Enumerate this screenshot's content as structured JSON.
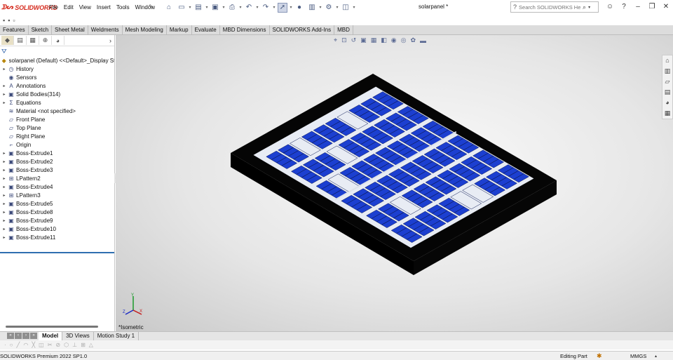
{
  "title_bar": {
    "logo_text": "SOLIDWORKS",
    "menus": [
      "File",
      "Edit",
      "View",
      "Insert",
      "Tools",
      "Window"
    ],
    "document_title": "solarpanel *",
    "search_placeholder": "Search SOLIDWORKS Help"
  },
  "command_tabs": [
    "Features",
    "Sketch",
    "Sheet Metal",
    "Weldments",
    "Mesh Modeling",
    "Markup",
    "Evaluate",
    "MBD Dimensions",
    "SOLIDWORKS Add-Ins",
    "MBD"
  ],
  "feature_tree": {
    "root": "solarpanel (Default) <<Default>_Display Stat",
    "items": [
      {
        "label": "History",
        "icon": "history-icon",
        "expandable": true
      },
      {
        "label": "Sensors",
        "icon": "sensors-icon",
        "expandable": false
      },
      {
        "label": "Annotations",
        "icon": "annotations-icon",
        "expandable": true
      },
      {
        "label": "Solid Bodies(314)",
        "icon": "solid-bodies-icon",
        "expandable": true
      },
      {
        "label": "Equations",
        "icon": "equations-icon",
        "expandable": true
      },
      {
        "label": "Material <not specified>",
        "icon": "material-icon",
        "expandable": false
      },
      {
        "label": "Front Plane",
        "icon": "plane-icon",
        "expandable": false
      },
      {
        "label": "Top Plane",
        "icon": "plane-icon",
        "expandable": false
      },
      {
        "label": "Right Plane",
        "icon": "plane-icon",
        "expandable": false
      },
      {
        "label": "Origin",
        "icon": "origin-icon",
        "expandable": false
      },
      {
        "label": "Boss-Extrude1",
        "icon": "extrude-icon",
        "expandable": true
      },
      {
        "label": "Boss-Extrude2",
        "icon": "extrude-icon",
        "expandable": true
      },
      {
        "label": "Boss-Extrude3",
        "icon": "extrude-icon",
        "expandable": true
      },
      {
        "label": "LPattern2",
        "icon": "pattern-icon",
        "expandable": true
      },
      {
        "label": "Boss-Extrude4",
        "icon": "extrude-icon",
        "expandable": true
      },
      {
        "label": "LPattern3",
        "icon": "pattern-icon",
        "expandable": true
      },
      {
        "label": "Boss-Extrude5",
        "icon": "extrude-icon",
        "expandable": true
      },
      {
        "label": "Boss-Extrude8",
        "icon": "extrude-icon",
        "expandable": true
      },
      {
        "label": "Boss-Extrude9",
        "icon": "extrude-icon",
        "expandable": true
      },
      {
        "label": "Boss-Extrude10",
        "icon": "extrude-icon",
        "expandable": true
      },
      {
        "label": "Boss-Extrude11",
        "icon": "extrude-icon",
        "expandable": true
      }
    ]
  },
  "graphics": {
    "view_label": "*Isometric",
    "triad_labels": [
      "X",
      "Y",
      "Z"
    ],
    "colors": {
      "frame": "#050505",
      "cell": "#1c3fd0",
      "cell_dark": "#0d1a55",
      "backsheet": "#e8ecf4"
    }
  },
  "bottom_tabs": [
    "Model",
    "3D Views",
    "Motion Study 1"
  ],
  "status_bar": {
    "product": "SOLIDWORKS Premium 2022 SP1.0",
    "mode": "Editing Part",
    "units": "MMGS"
  }
}
